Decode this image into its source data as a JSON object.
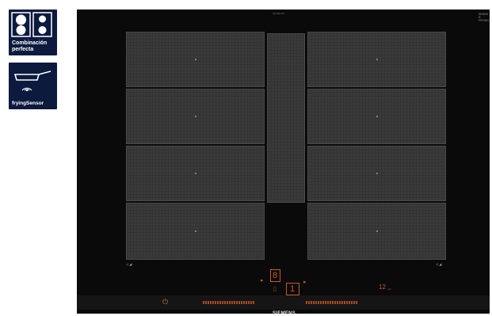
{
  "badges": [
    {
      "label": "Combinación perfecta",
      "icon": "dual-burner-icon"
    },
    {
      "label": "fryingSensor",
      "icon": "frying-pan-sensor-icon"
    }
  ],
  "hob": {
    "brand": "SIEMENS",
    "top_label": "SIEMENS",
    "top_right_label": "SENSOR FRYING",
    "colors": {
      "body": "#0a0a0a",
      "zone": "#3a3a3a",
      "controls": "#c55a2a"
    }
  },
  "controls": {
    "display_digit_left": "8",
    "display_digit_right": "1",
    "display_timer": "12",
    "display_timer_unit": "min"
  }
}
